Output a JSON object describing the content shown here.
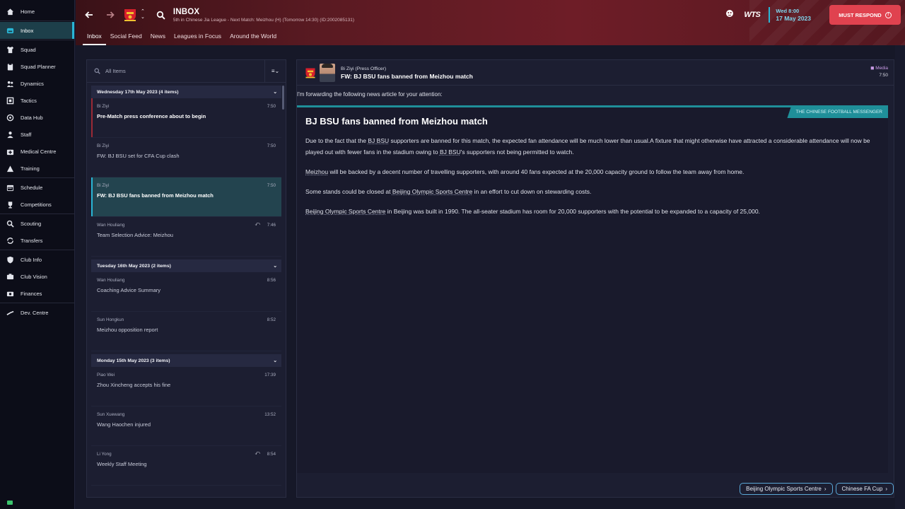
{
  "sidebar": {
    "items": [
      {
        "label": "Home",
        "icon": "home-icon"
      },
      {
        "label": "Inbox",
        "icon": "inbox-icon",
        "active": true
      },
      {
        "label": "Squad",
        "icon": "shirt-icon"
      },
      {
        "label": "Squad Planner",
        "icon": "clipboard-icon"
      },
      {
        "label": "Dynamics",
        "icon": "dynamics-icon"
      },
      {
        "label": "Tactics",
        "icon": "tactics-icon"
      },
      {
        "label": "Data Hub",
        "icon": "data-hub-icon"
      },
      {
        "label": "Staff",
        "icon": "staff-icon"
      },
      {
        "label": "Medical Centre",
        "icon": "medical-icon"
      },
      {
        "label": "Training",
        "icon": "training-icon"
      },
      {
        "label": "Schedule",
        "icon": "calendar-icon"
      },
      {
        "label": "Competitions",
        "icon": "trophy-icon"
      },
      {
        "label": "Scouting",
        "icon": "search-icon"
      },
      {
        "label": "Transfers",
        "icon": "transfer-icon"
      },
      {
        "label": "Club Info",
        "icon": "shield-icon"
      },
      {
        "label": "Club Vision",
        "icon": "vision-icon"
      },
      {
        "label": "Finances",
        "icon": "finances-icon"
      },
      {
        "label": "Dev. Centre",
        "icon": "dev-centre-icon"
      }
    ]
  },
  "header": {
    "title": "INBOX",
    "subtitle": "5th in Chinese Jia League - Next Match: Meizhou (H) (Tomorrow 14:30) (ID:2002085131)",
    "tabs": [
      "Inbox",
      "Social Feed",
      "News",
      "Leagues in Focus",
      "Around the World"
    ],
    "wts": "WTS",
    "date_day": "Wed 8:00",
    "date_full": "17 May 2023",
    "must_respond": "MUST RESPOND",
    "colors": {
      "accent": "#29b6d6",
      "brand": "#6e1d27",
      "alert": "#e0424f"
    }
  },
  "list": {
    "search_placeholder": "All Items",
    "groups": [
      {
        "header": "Wednesday 17th May 2023 (4 items)",
        "messages": [
          {
            "sender": "Bi Ziyi",
            "subject": "Pre-Match press conference about to begin",
            "time": "7:50"
          },
          {
            "sender": "Bi Ziyi",
            "subject": "FW: BJ BSU set for CFA Cup clash",
            "time": "7:50"
          },
          {
            "sender": "Bi Ziyi",
            "subject": "FW: BJ BSU fans banned from Meizhou match",
            "time": "7:50"
          },
          {
            "sender": "Wan Houliang",
            "subject": "Team Selection Advice: Meizhou",
            "time": "7:46"
          }
        ]
      },
      {
        "header": "Tuesday 16th May 2023 (2 items)",
        "messages": [
          {
            "sender": "Wan Houliang",
            "subject": "Coaching Advice Summary",
            "time": "8:56"
          },
          {
            "sender": "Sun Hongkun",
            "subject": "Meizhou opposition report",
            "time": "8:52"
          }
        ]
      },
      {
        "header": "Monday 15th May 2023 (3 items)",
        "messages": [
          {
            "sender": "Piao Wei",
            "subject": "Zhou Xincheng accepts his fine",
            "time": "17:39"
          },
          {
            "sender": "Sun Xuewang",
            "subject": "Wang Haochen injured",
            "time": "13:52"
          },
          {
            "sender": "Li Yong",
            "subject": "Weekly Staff Meeting",
            "time": "8:54"
          }
        ]
      }
    ]
  },
  "detail": {
    "sender_name": "Bi Ziyi",
    "sender_role": "(Press Officer)",
    "subject": "FW: BJ BSU fans banned from Meizhou match",
    "category": "Media",
    "time": "7:50",
    "intro": "I'm forwarding the following news article for your attention:",
    "publication": "THE CHINESE FOOTBALL MESSENGER",
    "article_title": "BJ BSU fans banned from Meizhou match",
    "p1_a": "Due to the fact that the ",
    "p1_link1": "BJ BSU",
    "p1_b": " supporters are banned for this match, the expected fan attendance will be much lower than usual.A fixture that might otherwise have attracted a considerable attendance will now be played out with fewer fans in the stadium owing to ",
    "p1_link2": "BJ BSU",
    "p1_c": "'s supporters not being permitted to watch.",
    "p2_link": "Meizhou",
    "p2_rest": " will be backed by a decent number of travelling supporters, with around 40 fans expected at the 20,000 capacity ground to follow the team away from home.",
    "p3_a": "Some stands could be closed at ",
    "p3_link": "Beijing Olympic Sports Centre",
    "p3_b": " in an effort to cut down on stewarding costs.",
    "p4_link": "Beijing Olympic Sports Centre",
    "p4_rest": " in Beijing was built in 1990. The all-seater stadium has room for 20,000 supporters with the potential to be expanded to a capacity of 25,000.",
    "links": [
      "Beijing Olympic Sports Centre",
      "Chinese FA Cup"
    ]
  }
}
